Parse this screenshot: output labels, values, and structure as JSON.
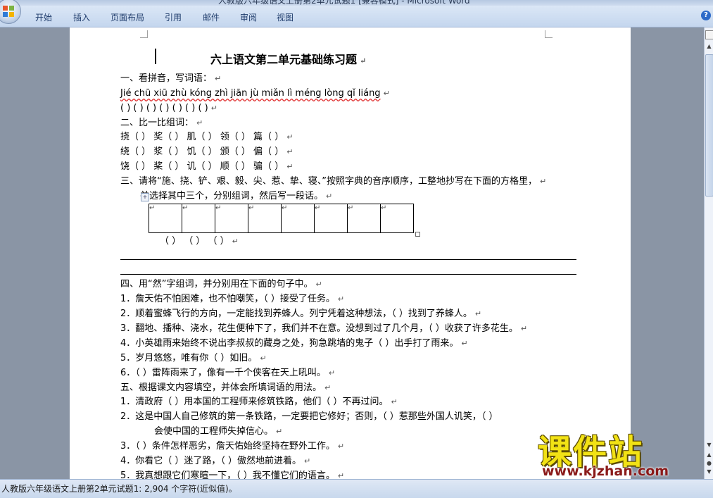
{
  "window": {
    "title": "人教版六年级语文上册第2单元试题1 [兼容模式] - Microsoft Word"
  },
  "ribbon": {
    "tabs": [
      "开始",
      "插入",
      "页面布局",
      "引用",
      "邮件",
      "审阅",
      "视图"
    ]
  },
  "help_icon": "?",
  "document": {
    "title": "六上语文第二单元基础练习题",
    "paragraph_mark": "↵",
    "lines": [
      "一、看拼音，写词语：",
      "Jié  chū  xiū  zhù  kóng  zhì  jiān  jù  miǎn  lì  méng  lòng  qǐ  liáng",
      "(      ) (      ) (      ) (      ) (      ) (      ) (      )",
      "二、比一比组词：",
      "挠（      ）  奖（      ）  肌（      ）  领（      ）  篇（      ）",
      "绕（      ）  浆（      ）  饥（      ）  颁（      ）  偏（      ）",
      "饶（      ）  桨（      ）  讥（      ）  顺（      ）  骗（      ）",
      "三、请将“施、挠、铲、艰、毅、尖、惹、挚、寝、”按照字典的音序顺序，工整地抄写在下面的方格里，",
      "并选择其中三个，分别组词，然后写一段话。",
      "（        ）  （        ）  （        ）",
      "四、用“然”字组词，并分别用在下面的句子中。",
      "1．詹天佑不怕困难，也不怕嘲笑，（        ）接受了任务。",
      "2．顺着蜜蜂飞行的方向，一定能找到养蜂人。列宁凭着这种想法，（        ）找到了养蜂人。",
      "3．翻地、播种、浇水，花生便种下了，我们并不在意。没想到过了几个月，（        ）收获了许多花生。",
      "4．小英雄雨来始终不说出李叔叔的藏身之处，狗急跳墙的鬼子（        ）出手打了雨来。",
      "5．岁月悠悠，唯有你（        ）如旧。",
      "6．（        ）雷阵雨来了，像有一千个侠客在天上吼叫。",
      "五、根据课文内容填空，并体会所填词语的用法。",
      "1．清政府（        ）用本国的工程师来修筑铁路，他们（        ）不再过问。",
      "2．这是中国人自己修筑的第一条铁路，一定要把它修好；否则，（        ）惹那些外国人讥笑，（        ）",
      "会使中国的工程师失掉信心。",
      "3．（        ）条件怎样恶劣，詹天佑始终坚持在野外工作。",
      "4．你看它（        ）迷了路，（        ）傲然地前进着。",
      "5．我真想跟它们寒暄一下，（        ）我不懂它们的语言。"
    ]
  },
  "statusbar": {
    "text": "人教版六年级语文上册第2单元试题1: 2,904 个字符(近似值)。"
  },
  "watermark": {
    "title": "课件站",
    "url": "www.kjzhan.com"
  }
}
